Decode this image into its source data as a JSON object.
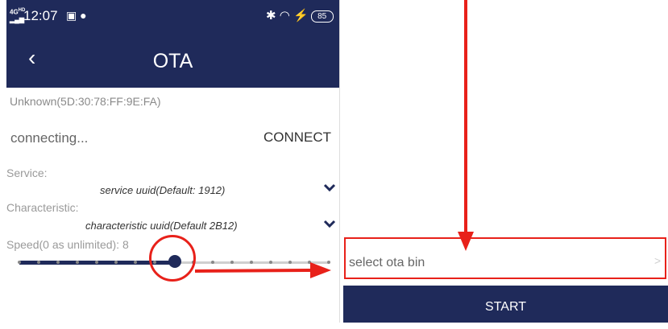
{
  "status_bar": {
    "network": "4G HD",
    "time": "12:07",
    "battery": "85"
  },
  "app_bar": {
    "back_glyph": "‹",
    "title": "OTA"
  },
  "device": {
    "name": "Unknown(5D:30:78:FF:9E:FA)"
  },
  "connection": {
    "status": "connecting...",
    "connect_label": "CONNECT"
  },
  "service": {
    "label": "Service:",
    "value": "service uuid(Default: 1912)"
  },
  "characteristic": {
    "label": "Characteristic:",
    "value": "characteristic uuid(Default 2B12)"
  },
  "speed": {
    "label": "Speed(0 as unlimited): 8",
    "value": 8,
    "steps": 17
  },
  "ota": {
    "select_label": "select ota bin",
    "start_label": "START"
  },
  "colors": {
    "primary": "#1f2a5a",
    "annotation": "#e8211a"
  },
  "icons": {
    "back": "back-arrow-icon",
    "chevron": "chevron-down-icon",
    "select_chevron": "chevron-right-icon"
  }
}
